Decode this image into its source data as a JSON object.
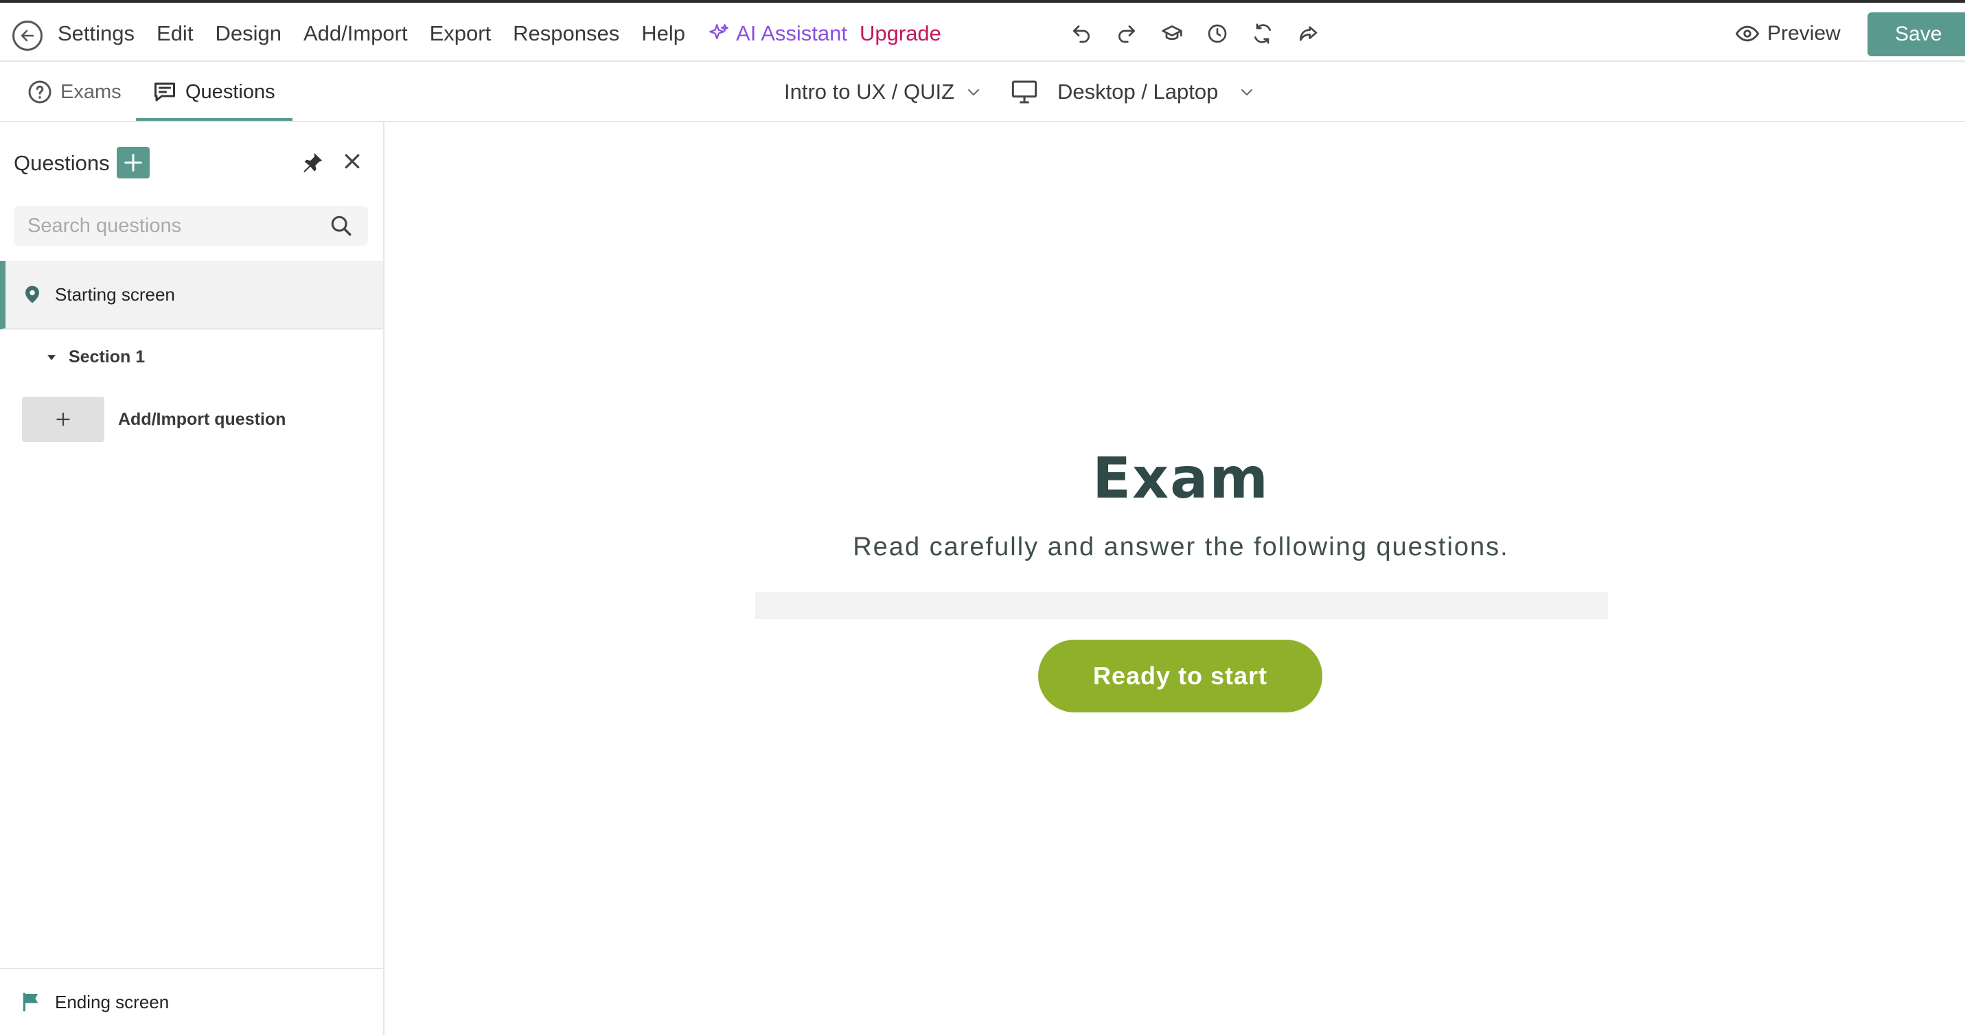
{
  "menu": {
    "settings": "Settings",
    "edit": "Edit",
    "design": "Design",
    "add_import": "Add/Import",
    "export": "Export",
    "responses": "Responses",
    "help": "Help",
    "ai_assistant": "AI Assistant",
    "upgrade": "Upgrade"
  },
  "toolbar_icons": [
    "undo-icon",
    "redo-icon",
    "graduation-cap-icon",
    "clock-icon",
    "refresh-icon",
    "share-icon"
  ],
  "header": {
    "preview_label": "Preview",
    "save_label": "Save"
  },
  "tabs": {
    "exams": "Exams",
    "questions": "Questions"
  },
  "selectors": {
    "quiz": "Intro to UX / QUIZ",
    "device": "Desktop / Laptop"
  },
  "sidebar": {
    "title": "Questions",
    "search_placeholder": "Search questions",
    "starting_screen": "Starting screen",
    "section": "Section 1",
    "add_import_question": "Add/Import question",
    "ending_screen": "Ending screen"
  },
  "canvas": {
    "title": "Exam",
    "subtitle": "Read carefully and answer the following questions.",
    "start_button": "Ready to start"
  },
  "colors": {
    "accent": "#5a9a8e",
    "ai_purple": "#8a4fe0",
    "upgrade": "#c2185b",
    "start_button": "#8fb02b",
    "title": "#2f4a48"
  }
}
